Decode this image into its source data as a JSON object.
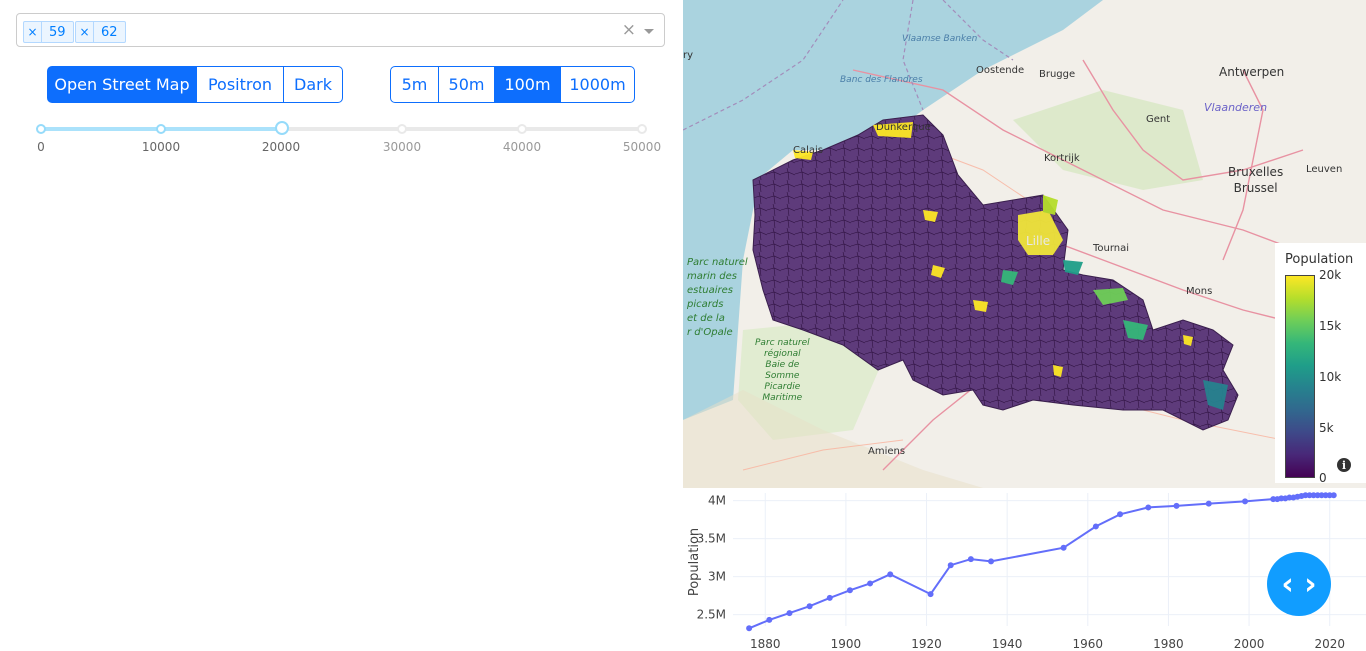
{
  "department_select": {
    "selected": [
      "59",
      "62"
    ],
    "remove_glyph": "×",
    "clear_glyph": "×"
  },
  "basemap_buttons": [
    {
      "label": "Open Street Map",
      "active": true
    },
    {
      "label": "Positron",
      "active": false
    },
    {
      "label": "Dark",
      "active": false
    }
  ],
  "resolution_buttons": [
    {
      "label": "5m",
      "active": false
    },
    {
      "label": "50m",
      "active": false
    },
    {
      "label": "100m",
      "active": true
    },
    {
      "label": "1000m",
      "active": false
    }
  ],
  "population_slider": {
    "marks": [
      "0",
      "10000",
      "20000",
      "30000",
      "40000",
      "50000"
    ],
    "min": 0,
    "max": 50000,
    "value": 20000
  },
  "map": {
    "places": {
      "vlaamse_banken": "Vlaamse\nBanken",
      "banc_des_flandres": "Banc des\nFlandres",
      "oostende": "Oostende",
      "brugge": "Brugge",
      "antwerpen": "Antwerpen",
      "gent": "Gent",
      "vlaanderen": "Vlaanderen",
      "bruxelles": "Bruxelles\nBrussel",
      "leuven": "Leuven",
      "kortrijk": "Kortrijk",
      "dunkerque": "Dunkerque",
      "calais": "Calais",
      "lille": "Lille",
      "tournai": "Tournai",
      "mons": "Mons",
      "amiens": "Amiens",
      "parc_opale": "Parc naturel\nmarin des\nestuaires\npicards\net de la\nr d'Opale",
      "parc_somme": "Parc naturel\nrégional\nBaie de\nSomme\nPicardie\nMaritime",
      "ry": "ry"
    },
    "colorbar": {
      "title": "Population",
      "ticks": [
        "20k",
        "15k",
        "10k",
        "5k",
        "0"
      ]
    },
    "info_icon": "i"
  },
  "chart_data": {
    "type": "line",
    "ylabel": "Population",
    "xlabel": "",
    "x_ticks": [
      "1880",
      "1900",
      "1920",
      "1940",
      "1960",
      "1980",
      "2000",
      "2020"
    ],
    "y_ticks": [
      "2.5M",
      "3M",
      "3.5M",
      "4M"
    ],
    "xlim": [
      1872,
      2029
    ],
    "ylim": [
      2.35,
      4.1
    ],
    "color": "#636efa",
    "x": [
      1876,
      1881,
      1886,
      1891,
      1896,
      1901,
      1906,
      1911,
      1921,
      1926,
      1931,
      1936,
      1954,
      1962,
      1968,
      1975,
      1982,
      1990,
      1999,
      2006,
      2007,
      2008,
      2009,
      2010,
      2011,
      2012,
      2013,
      2014,
      2015,
      2016,
      2017,
      2018,
      2019,
      2020,
      2021
    ],
    "y": [
      2.32,
      2.43,
      2.52,
      2.61,
      2.72,
      2.82,
      2.91,
      3.03,
      2.77,
      3.15,
      3.23,
      3.2,
      3.38,
      3.66,
      3.82,
      3.91,
      3.93,
      3.96,
      3.99,
      4.02,
      4.02,
      4.03,
      4.03,
      4.04,
      4.04,
      4.05,
      4.06,
      4.07,
      4.07,
      4.07,
      4.07,
      4.07,
      4.07,
      4.07,
      4.07
    ]
  },
  "code_button": {
    "glyph": "‹ ›"
  }
}
